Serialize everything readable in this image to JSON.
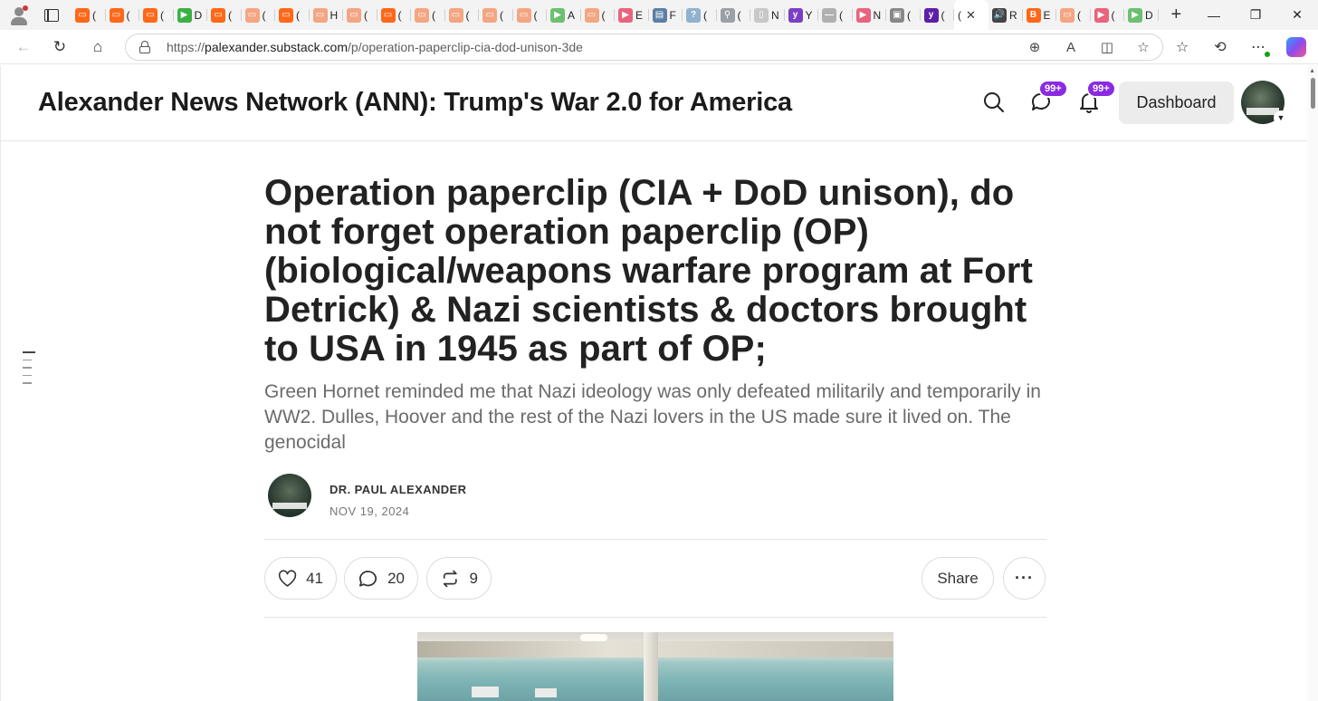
{
  "browser": {
    "tabs": [
      {
        "letter": "(",
        "color": "#ff6719",
        "glyph": "▭"
      },
      {
        "letter": "(",
        "color": "#ff6719",
        "glyph": "▭"
      },
      {
        "letter": "(",
        "color": "#ff6719",
        "glyph": "▭"
      },
      {
        "letter": "D",
        "color": "#3cb043",
        "glyph": "▶"
      },
      {
        "letter": "(",
        "color": "#ff6719",
        "glyph": "▭"
      },
      {
        "letter": "(",
        "color": "#f4a582",
        "glyph": "▭"
      },
      {
        "letter": "(",
        "color": "#ff6719",
        "glyph": "▭"
      },
      {
        "letter": "H",
        "color": "#f4a582",
        "glyph": "▭"
      },
      {
        "letter": "(",
        "color": "#f4a582",
        "glyph": "▭"
      },
      {
        "letter": "(",
        "color": "#ff6719",
        "glyph": "▭"
      },
      {
        "letter": "(",
        "color": "#f4a582",
        "glyph": "▭"
      },
      {
        "letter": "(",
        "color": "#f4a582",
        "glyph": "▭"
      },
      {
        "letter": "(",
        "color": "#f4a582",
        "glyph": "▭"
      },
      {
        "letter": "(",
        "color": "#f4a582",
        "glyph": "▭"
      },
      {
        "letter": "A",
        "color": "#6cc070",
        "glyph": "▶"
      },
      {
        "letter": "(",
        "color": "#f4a582",
        "glyph": "▭"
      },
      {
        "letter": "E",
        "color": "#e8647c",
        "glyph": "▶"
      },
      {
        "letter": "F",
        "color": "#5b7fa6",
        "glyph": "▤"
      },
      {
        "letter": "(",
        "color": "#8fb3cf",
        "glyph": "?"
      },
      {
        "letter": "(",
        "color": "#9aa0a6",
        "glyph": "⚲"
      },
      {
        "letter": "N",
        "color": "#c8c8c8",
        "glyph": "▯"
      },
      {
        "letter": "Y",
        "color": "#7b3fc4",
        "glyph": "y"
      },
      {
        "letter": "(",
        "color": "#b0b0b0",
        "glyph": "—"
      },
      {
        "letter": "N",
        "color": "#e8647c",
        "glyph": "▶"
      },
      {
        "letter": "(",
        "color": "#888888",
        "glyph": "▣"
      },
      {
        "letter": "(",
        "color": "#5c1fa8",
        "glyph": "y"
      }
    ],
    "active_tab": {
      "letter": "(",
      "close": "✕"
    },
    "tabs_after": [
      {
        "letter": "R",
        "color": "#444444",
        "glyph": "🔊"
      },
      {
        "letter": "E",
        "color": "#ff6719",
        "glyph": "B"
      },
      {
        "letter": "(",
        "color": "#f4a582",
        "glyph": "▭"
      },
      {
        "letter": "(",
        "color": "#e8647c",
        "glyph": "▶"
      },
      {
        "letter": "D",
        "color": "#6cc070",
        "glyph": "▶"
      }
    ],
    "url": {
      "prefix": "https://",
      "host": "palexander.substack.com",
      "path": "/p/operation-paperclip-cia-dod-unison-3de"
    }
  },
  "site": {
    "title": "Alexander News Network (ANN): Trump's War 2.0 for America",
    "chat_badge": "99+",
    "notif_badge": "99+",
    "dashboard_label": "Dashboard"
  },
  "post": {
    "title": "Operation paperclip (CIA + DoD unison), do not forget operation paperclip (OP) (biological/weapons warfare program at Fort Detrick) & Nazi scientists & doctors brought to USA in 1945 as part of OP;",
    "subtitle": "Green Hornet reminded me that Nazi ideology was only defeated militarily and temporarily in WW2. Dulles, Hoover and the rest of the Nazi lovers in the US made sure it lived on. The genocidal",
    "author": "DR. PAUL ALEXANDER",
    "date": "NOV 19, 2024",
    "likes": "41",
    "comments": "20",
    "restacks": "9",
    "share_label": "Share"
  },
  "colors": {
    "badge": "#8a2be2",
    "substack_orange": "#ff6719"
  }
}
